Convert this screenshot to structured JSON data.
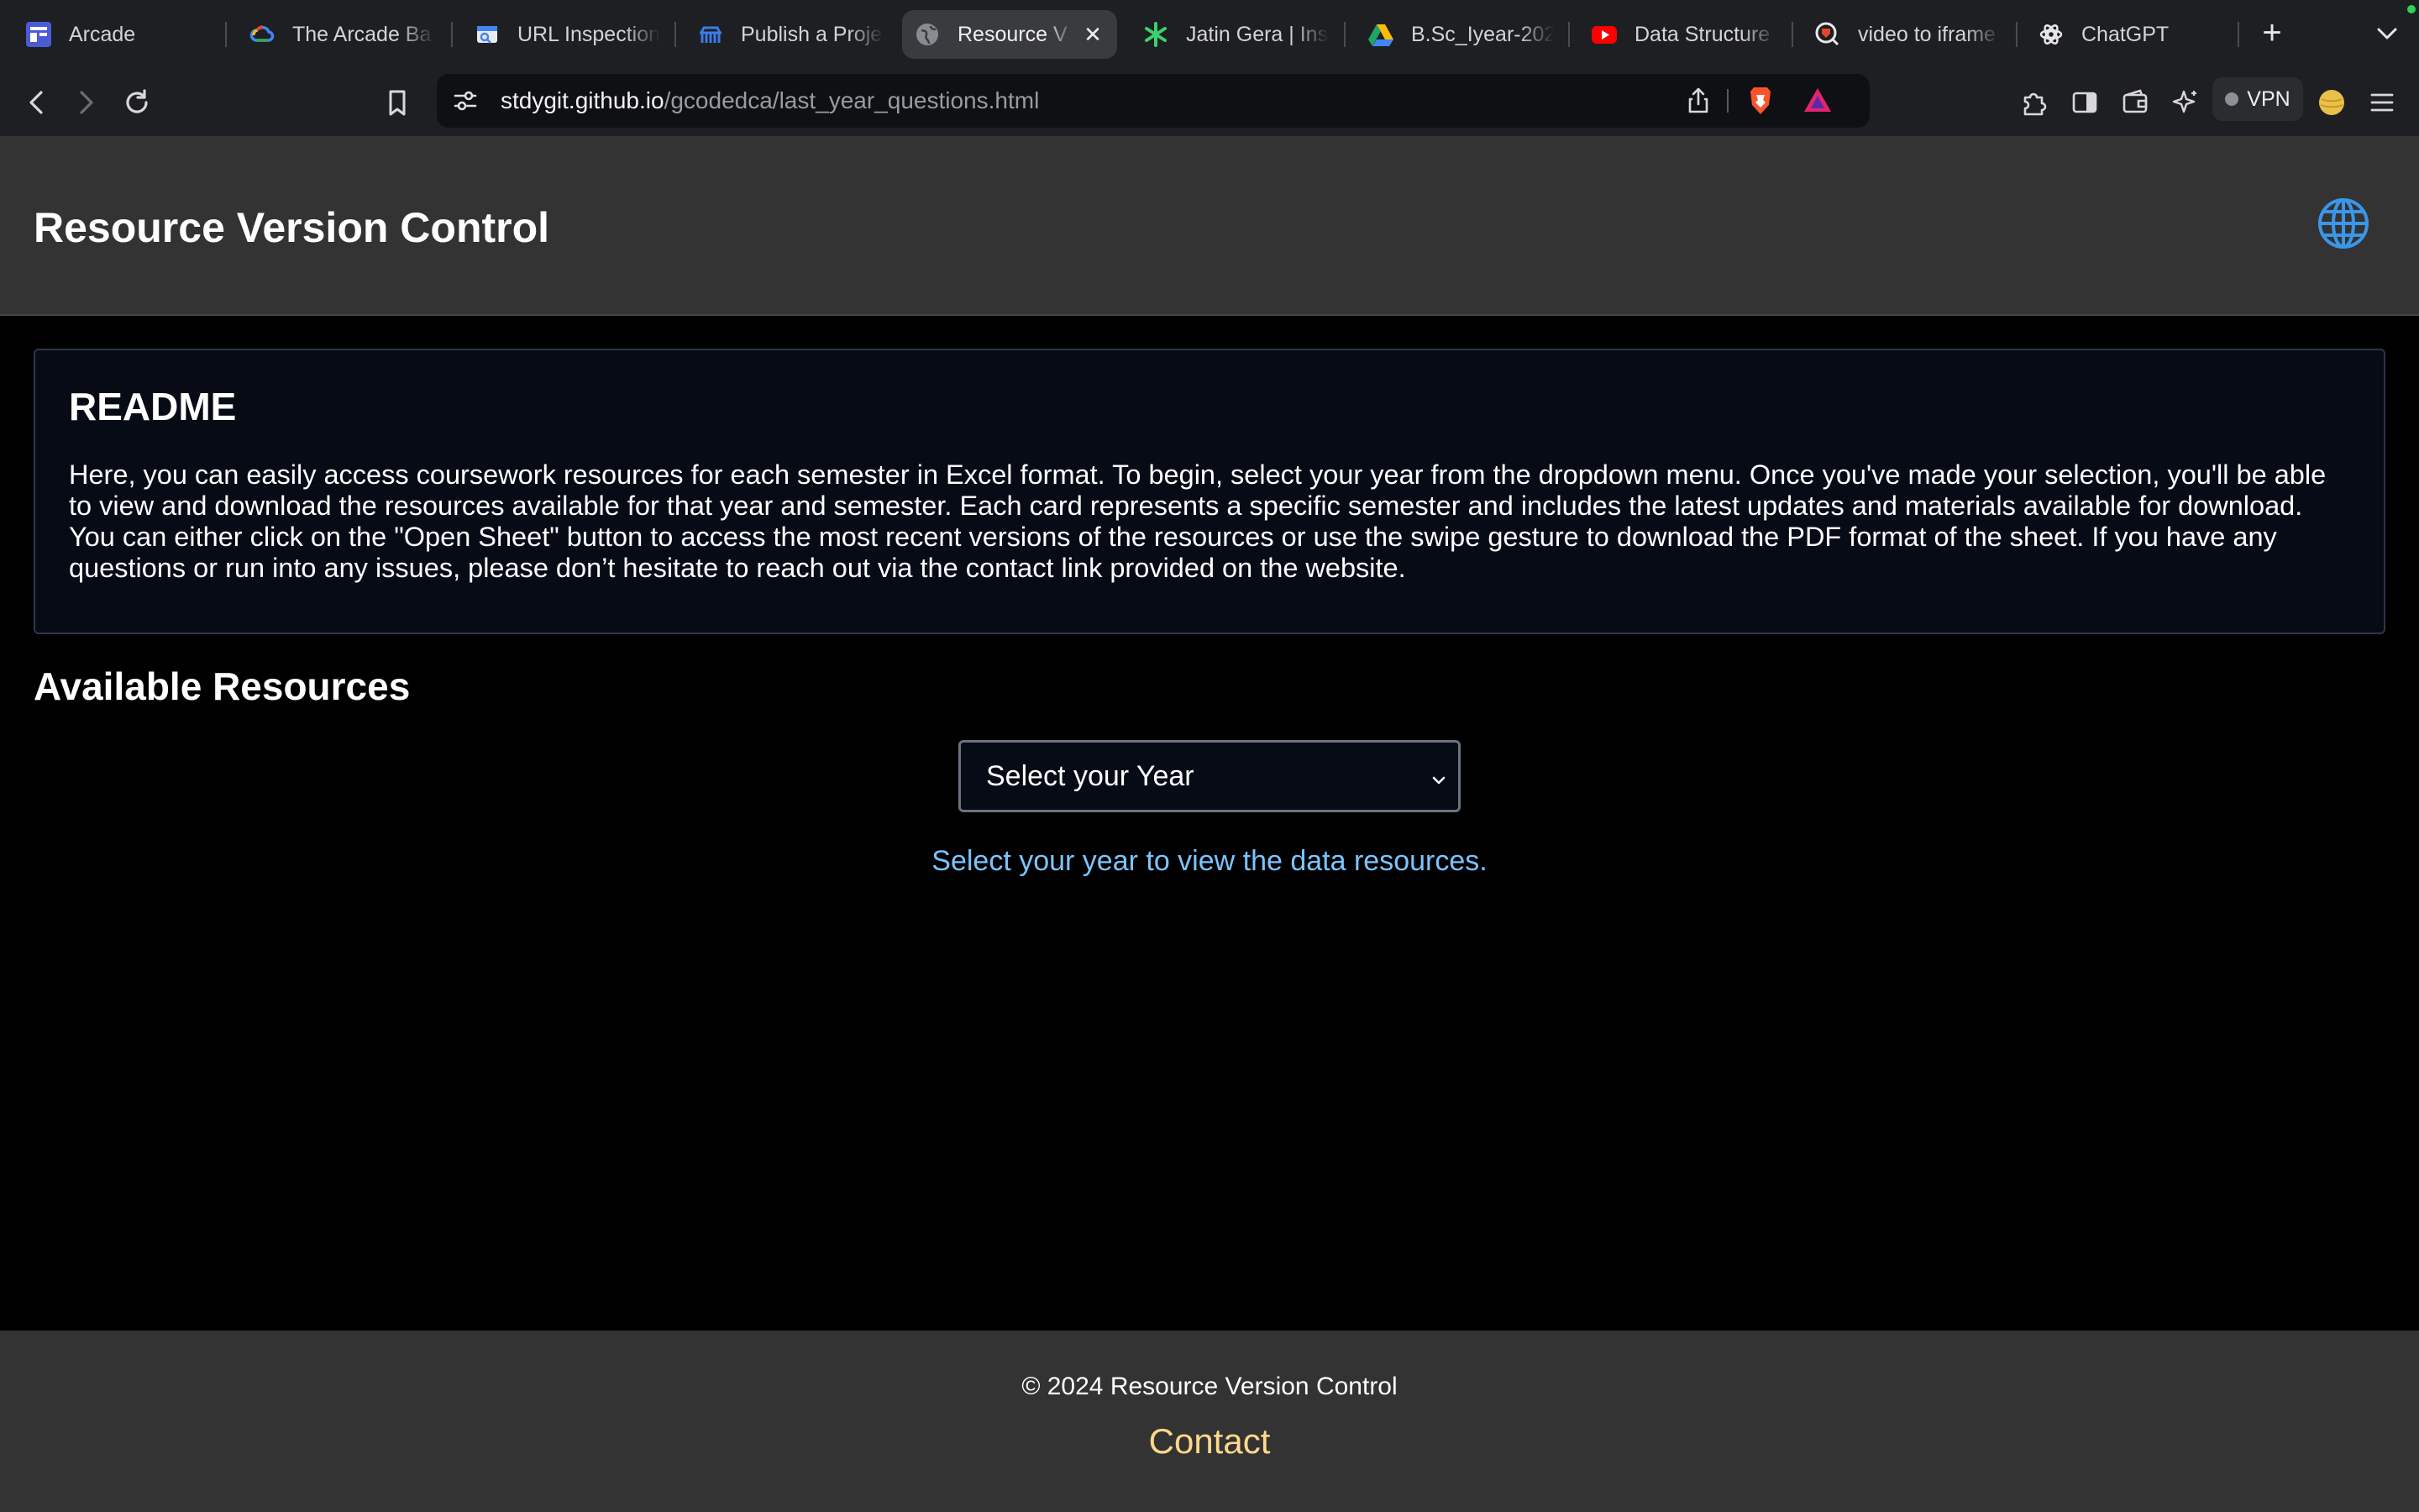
{
  "browser": {
    "tabs": [
      {
        "label": "Arcade",
        "icon": "arcade-icon",
        "active": false
      },
      {
        "label": "The Arcade Ba",
        "icon": "google-cloud-icon",
        "active": false
      },
      {
        "label": "URL Inspection",
        "icon": "search-console-icon",
        "active": false
      },
      {
        "label": "Publish a Proje",
        "icon": "publish-icon",
        "active": false
      },
      {
        "label": "Resource V",
        "icon": "globe-icon",
        "active": true
      },
      {
        "label": "Jatin Gera | Ins",
        "icon": "green-star-icon",
        "active": false
      },
      {
        "label": "B.Sc_Iyear-202",
        "icon": "google-drive-icon",
        "active": false
      },
      {
        "label": "Data Structure",
        "icon": "youtube-icon",
        "active": false
      },
      {
        "label": "video to iframe",
        "icon": "brave-search-icon",
        "active": false
      },
      {
        "label": "ChatGPT",
        "icon": "chatgpt-icon",
        "active": false
      }
    ],
    "close_glyph": "✕",
    "new_tab_glyph": "+",
    "url_host": "stdygit.github.io",
    "url_path": "/gcodedca/last_year_questions.html",
    "vpn_label": "VPN"
  },
  "header": {
    "title": "Resource Version Control",
    "globe_icon": "globe-icon",
    "globe_color": "#3b96e8",
    "background": "#333333"
  },
  "readme": {
    "title": "README",
    "body": "Here, you can easily access coursework resources for each semester in Excel format. To begin, select your year from the dropdown menu. Once you've made your selection, you'll be able to view and download the resources available for that year and semester. Each card represents a specific semester and includes the latest updates and materials available for download. You can either click on the \"Open Sheet\" button to access the most recent versions of the resources or use the swipe gesture to download the PDF format of the sheet. If you have any questions or run into any issues, please don’t hesitate to reach out via the contact link provided on the website."
  },
  "resources": {
    "title": "Available Resources",
    "select_value": "Select your Year",
    "hint": "Select your year to view the data resources.",
    "hint_color": "#7cc4ff"
  },
  "footer": {
    "copyright": "© 2024 Resource Version Control",
    "contact": "Contact",
    "contact_color": "#ffd88a"
  }
}
